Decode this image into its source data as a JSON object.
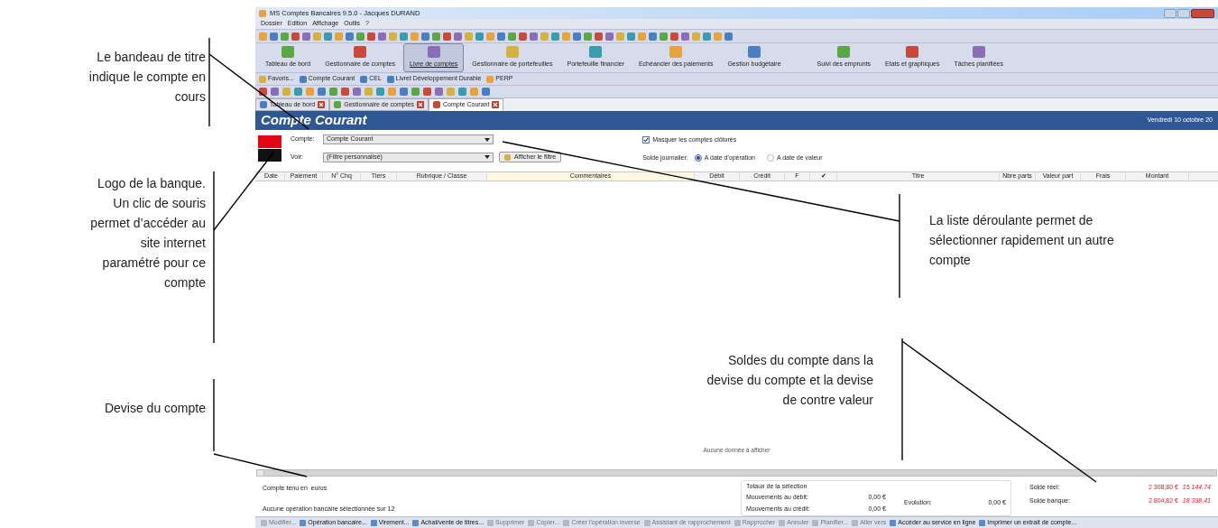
{
  "left_annotations": [
    "Le bandeau de titre indique le compte en cours",
    "Logo de la banque. Un clic de souris permet d’accéder au site internet paramétré pour ce compte",
    "Devise du compte"
  ],
  "right_annotations": [
    "La liste déroulante permet de sélectionner rapidement un autre compte",
    "Soldes du compte dans la devise du compte et la devise de contre valeur"
  ],
  "window": {
    "title": "MS Comptes Bancaires 9.5.0  - Jacques DURAND"
  },
  "menu": [
    "Dossier",
    "Edition",
    "Affichage",
    "Outils",
    "?"
  ],
  "nav": [
    {
      "label": "Tableau de bord",
      "selected": false
    },
    {
      "label": "Gestionnaire de comptes",
      "selected": false
    },
    {
      "label": "Livre de comptes",
      "selected": true
    },
    {
      "label": "Gestionnaire de portefeuilles",
      "selected": false
    },
    {
      "label": "Portefeuille financier",
      "selected": false
    },
    {
      "label": "Echéancier des paiements",
      "selected": false
    },
    {
      "label": "Gestion budgétaire",
      "selected": false
    },
    {
      "label": "Suivi des emprunts",
      "selected": false
    },
    {
      "label": "Etats et graphiques",
      "selected": false
    },
    {
      "label": "Tâches planifiées",
      "selected": false
    }
  ],
  "favorites": [
    "Favoris...",
    "Compte Courant",
    "CEL",
    "Livret Développement Durable",
    "PERP"
  ],
  "tabs": [
    {
      "label": "Tableau de bord",
      "selected": false
    },
    {
      "label": "Gestionnaire de comptes",
      "selected": false
    },
    {
      "label": "Compte Courant",
      "selected": true
    }
  ],
  "banner": {
    "title": "Compte Courant",
    "date": "Vendredi 10 octobre 20"
  },
  "form": {
    "compte_label": "Compte:",
    "compte_value": "Compte Courant",
    "voir_label": "Voir:",
    "voir_value": "(Filtre personnalisé)",
    "filter_button": "Afficher le filtre",
    "hide_closed": {
      "label": "Masquer les comptes clôturés",
      "checked": true
    },
    "solde_label": "Solde journalier:",
    "radios": [
      {
        "label": "A date d'opération",
        "selected": true
      },
      {
        "label": "A date de valeur",
        "selected": false
      }
    ]
  },
  "table": {
    "columns": [
      {
        "label": "Date",
        "highlighted": false
      },
      {
        "label": "Paiement",
        "highlighted": false
      },
      {
        "label": "N° Chq",
        "highlighted": false
      },
      {
        "label": "Tiers",
        "highlighted": false
      },
      {
        "label": "Rubrique / Classe",
        "highlighted": false
      },
      {
        "label": "Commentaires",
        "highlighted": true
      },
      {
        "label": "Débit",
        "highlighted": false
      },
      {
        "label": "Crédit",
        "highlighted": false
      },
      {
        "label": "F",
        "highlighted": false
      },
      {
        "label": "✔",
        "highlighted": false
      },
      {
        "label": "Titre",
        "highlighted": false
      },
      {
        "label": "Nbre parts",
        "highlighted": false
      },
      {
        "label": "Valeur part",
        "highlighted": false
      },
      {
        "label": "Frais",
        "highlighted": false
      },
      {
        "label": "Montant",
        "highlighted": false
      }
    ],
    "empty_text": "Aucune donnée à afficher"
  },
  "footer": {
    "currency": "Compte tenu en  euros",
    "selection": "Aucune opération bancaire sélectionnée sur 12",
    "totals_title": "Totaux de la sélection",
    "debit_label": "Mouvements au débit:",
    "debit": "0,00 €",
    "credit_label": "Mouvements au crédit:",
    "credit": "0,00 €",
    "evolution_label": "Evolution:",
    "evolution": "0,00 €",
    "balances": [
      {
        "label": "Solde réel:",
        "value": "2 308,80 €",
        "counter": "15 144,74"
      },
      {
        "label": "Solde banque:",
        "value": "2 804,82 €",
        "counter": "18 398,41"
      }
    ]
  },
  "actions": [
    {
      "label": "Modifier...",
      "disabled": true
    },
    {
      "label": "Opération bancaire...",
      "disabled": false
    },
    {
      "label": "Virement...",
      "disabled": false
    },
    {
      "label": "Achat/vente de titres...",
      "disabled": false
    },
    {
      "label": "Supprimer",
      "disabled": true
    },
    {
      "label": "Copier...",
      "disabled": true
    },
    {
      "label": "Créer l'opération inverse",
      "disabled": true
    },
    {
      "label": "Assistant de rapprochement",
      "disabled": true
    },
    {
      "label": "Rapprocher",
      "disabled": true
    },
    {
      "label": "Annuler",
      "disabled": true
    },
    {
      "label": "Planifier...",
      "disabled": true
    },
    {
      "label": "Aller vers",
      "disabled": true
    },
    {
      "label": "Accéder au service en ligne",
      "disabled": false
    },
    {
      "label": "Imprimer un extrait de compte...",
      "disabled": false
    }
  ]
}
